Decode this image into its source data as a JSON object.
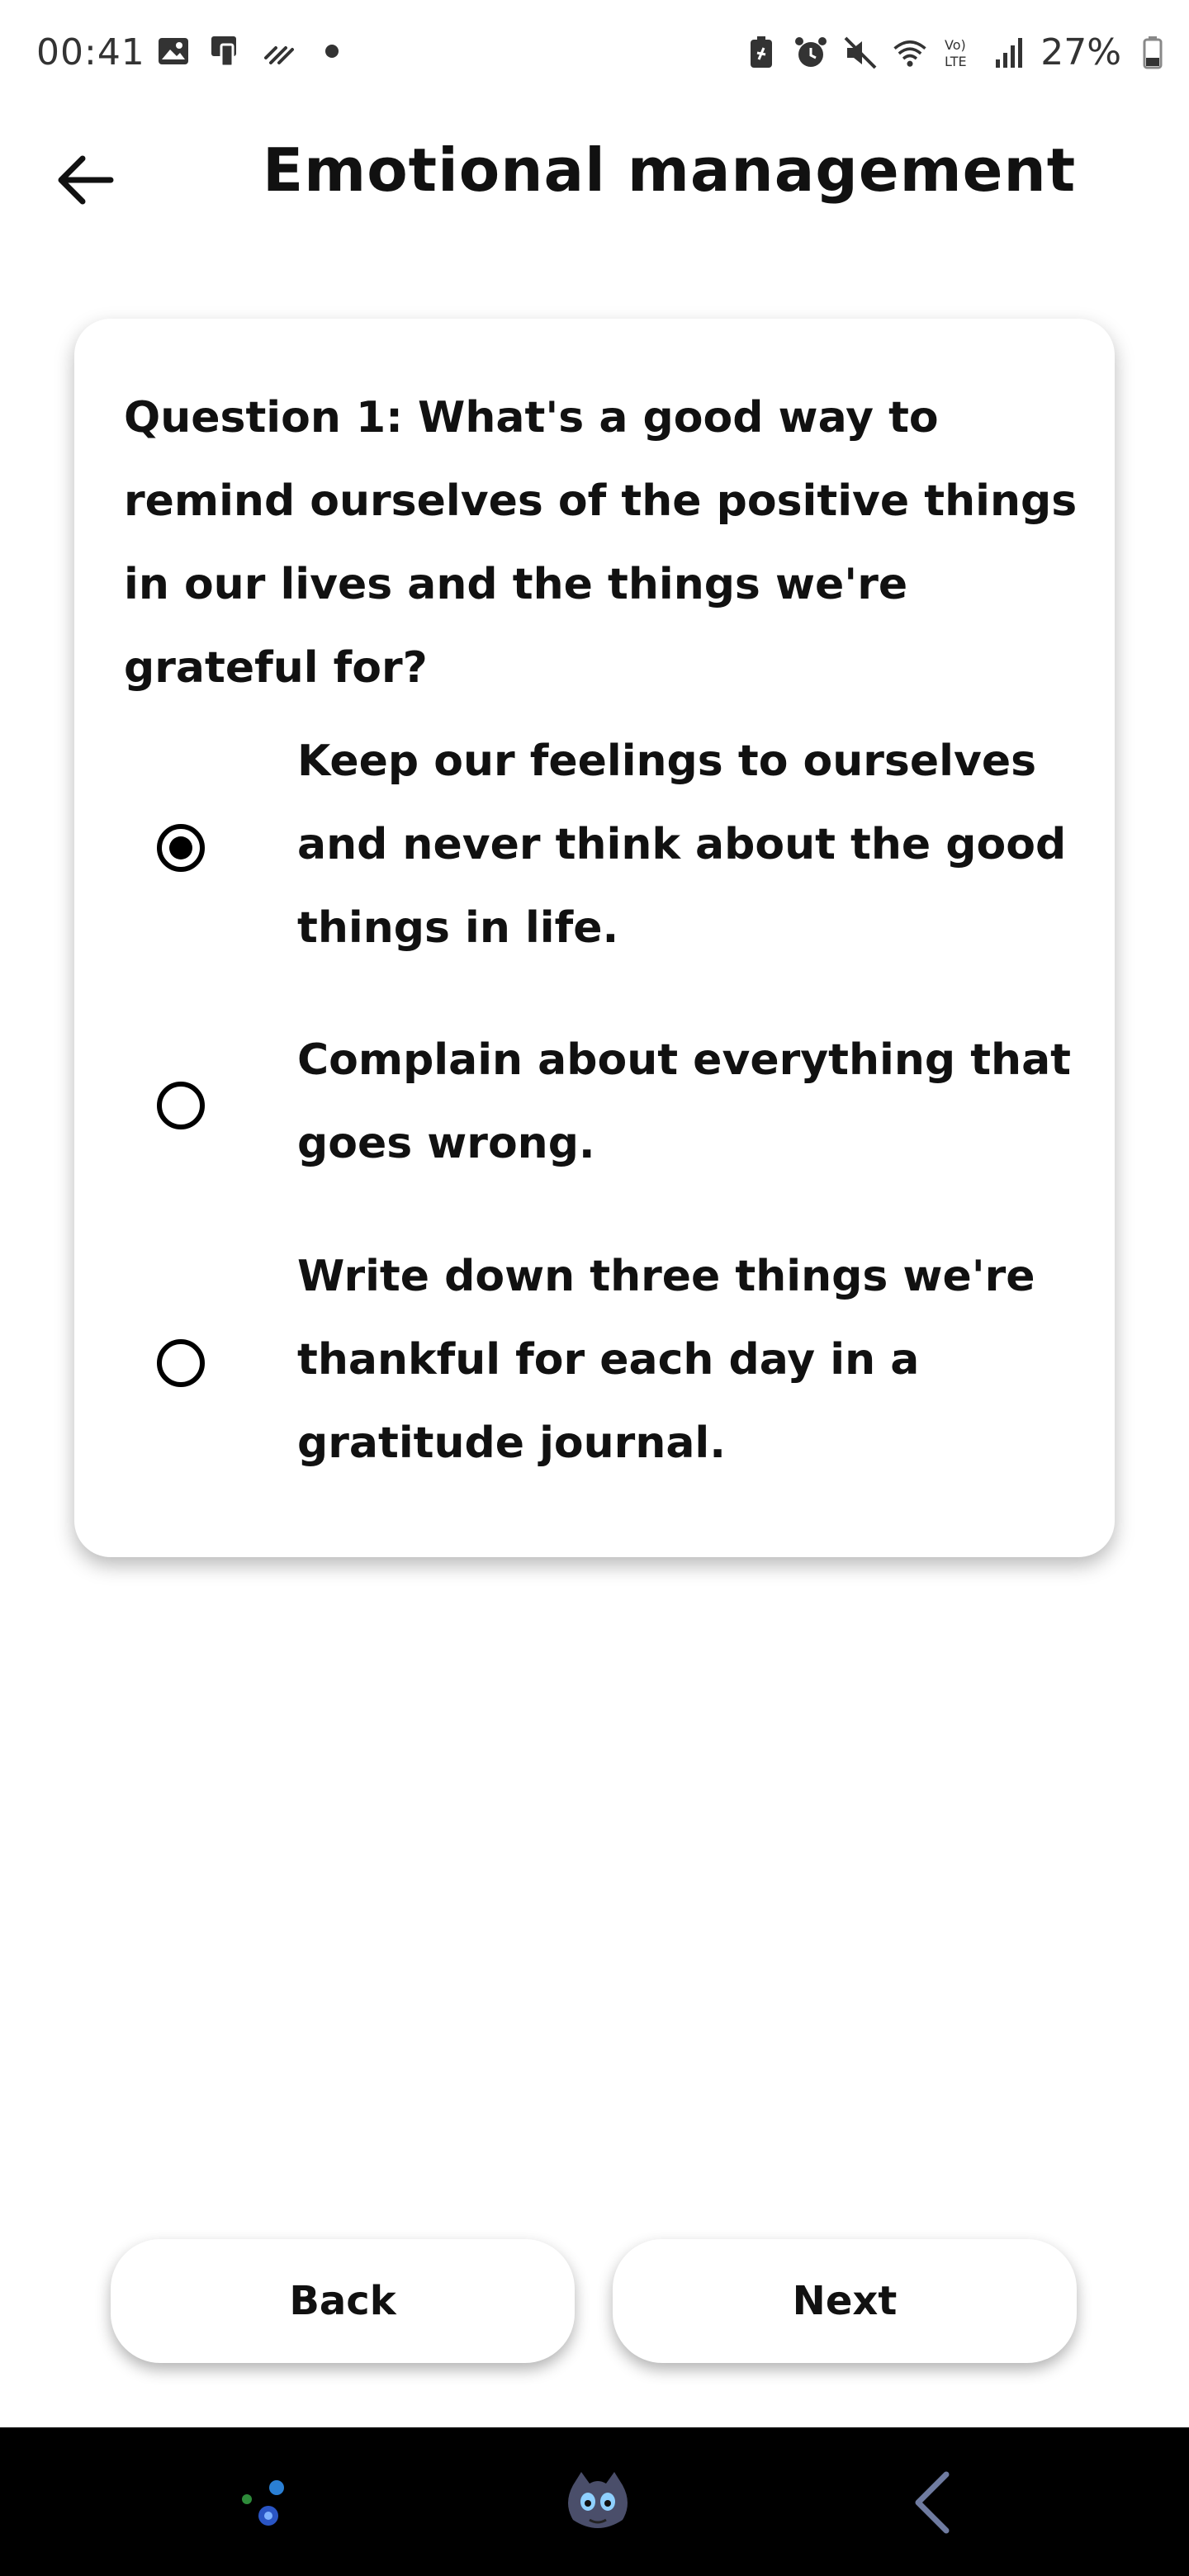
{
  "status_bar": {
    "time": "00:41",
    "battery_percent": "27%",
    "icons": [
      "image-icon",
      "device-icon",
      "sync-icon",
      "dot-icon",
      "battery-saver-icon",
      "alarm-icon",
      "mute-icon",
      "wifi-icon",
      "volte-icon",
      "signal-icon",
      "battery-icon"
    ]
  },
  "header": {
    "title": "Emotional management",
    "back_icon": "arrow-left-icon"
  },
  "quiz": {
    "question": "Question 1: What's a good way to remind ourselves of the positive things in our lives and the things we're grateful for?",
    "options": [
      {
        "label": "Keep our feelings to ourselves and never think about the good things in life.",
        "selected": true
      },
      {
        "label": "Complain about everything that goes wrong.",
        "selected": false
      },
      {
        "label": "Write down three things we're thankful for each day in a gratitude journal.",
        "selected": false
      }
    ]
  },
  "buttons": {
    "back_label": "Back",
    "next_label": "Next"
  },
  "navbar": {
    "items": [
      "sparkle-app-icon",
      "creature-avatar-icon",
      "back-gesture-icon"
    ]
  }
}
